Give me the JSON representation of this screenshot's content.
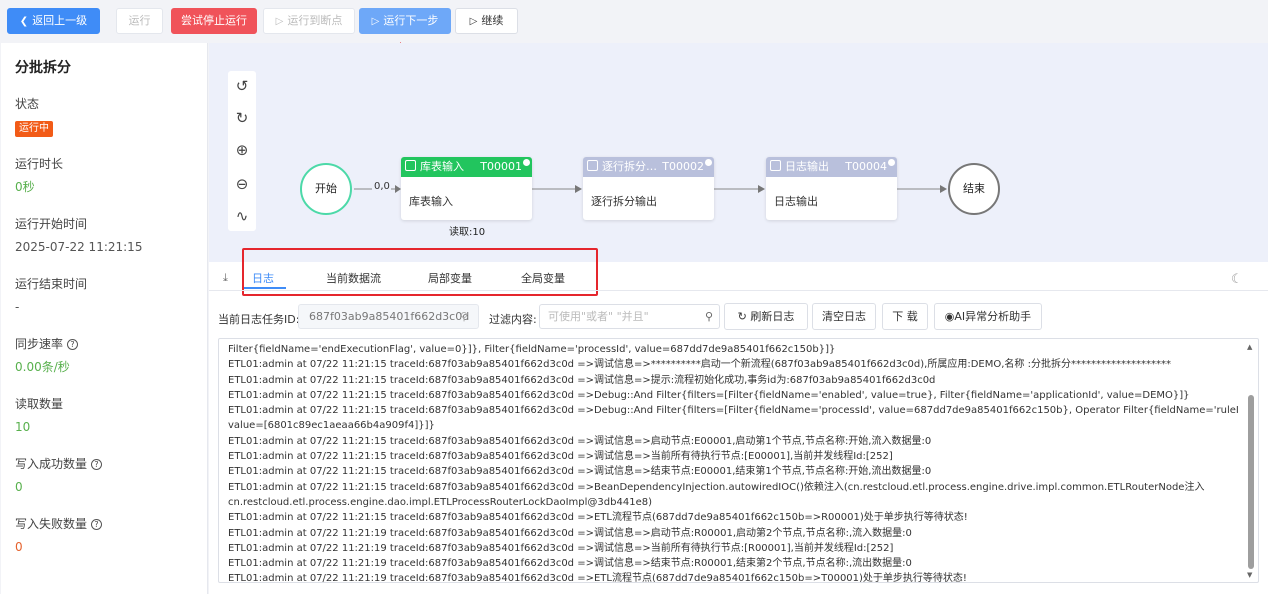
{
  "toolbar": {
    "back": "返回上一级",
    "run": "运行",
    "stop": "尝试停止运行",
    "run_to_breakpoint": "运行到断点",
    "run_next": "运行下一步",
    "continue": "继续"
  },
  "sidebar": {
    "title": "分批拆分",
    "stats": [
      {
        "label": "状态",
        "value": "运行中"
      },
      {
        "label": "运行时长",
        "value": "0秒"
      },
      {
        "label": "运行开始时间",
        "value": "2025-07-22 11:21:15"
      },
      {
        "label": "运行结束时间",
        "value": "-"
      },
      {
        "label": "同步速率",
        "value": "0.00条/秒"
      },
      {
        "label": "读取数量",
        "value": "10"
      },
      {
        "label": "写入成功数量",
        "value": "0"
      },
      {
        "label": "写入失败数量",
        "value": "0"
      }
    ]
  },
  "flow": {
    "start": "开始",
    "end": "结束",
    "edge_label": "0,0",
    "read_label": "读取:10",
    "nodes": [
      {
        "name": "库表输入",
        "code": "T00001",
        "body": "库表输入"
      },
      {
        "name": "逐行拆分…",
        "code": "T00002",
        "body": "逐行拆分输出"
      },
      {
        "name": "日志输出",
        "code": "T00004",
        "body": "日志输出"
      }
    ]
  },
  "tabs": [
    "日志",
    "当前数据流",
    "局部变量",
    "全局变量"
  ],
  "filter": {
    "task_label": "当前日志任务ID:",
    "task_value": "687f03ab9a85401f662d3c0d",
    "filter_label": "过滤内容:",
    "filter_placeholder": "可使用\"或者\" \"并且\"",
    "refresh": "刷新日志",
    "clear": "清空日志",
    "download": "下 载",
    "ai": "AI异常分析助手"
  },
  "log_lines": [
    "Filter{fieldName='endExecutionFlag', value=0}]}, Filter{fieldName='processId', value=687dd7de9a85401f662c150b}]}",
    "ETL01:admin at 07/22 11:21:15 traceId:687f03ab9a85401f662d3c0d =>调试信息=>**********启动一个新流程(687f03ab9a85401f662d3c0d),所属应用:DEMO,名称 :分批拆分********************",
    "ETL01:admin at 07/22 11:21:15 traceId:687f03ab9a85401f662d3c0d =>调试信息=>提示:流程初始化成功,事务id为:687f03ab9a85401f662d3c0d",
    "ETL01:admin at 07/22 11:21:15 traceId:687f03ab9a85401f662d3c0d =>Debug::And Filter{filters=[Filter{fieldName='enabled', value=true}, Filter{fieldName='applicationId', value=DEMO}]}",
    "ETL01:admin at 07/22 11:21:15 traceId:687f03ab9a85401f662d3c0d =>Debug::And Filter{filters=[Filter{fieldName='processId', value=687dd7de9a85401f662c150b}, Operator Filter{fieldName='ruleId', operator='$in',",
    "value=[6801c89ec1aeaa66b4a909f4]}]}",
    "ETL01:admin at 07/22 11:21:15 traceId:687f03ab9a85401f662d3c0d =>调试信息=>启动节点:E00001,启动第1个节点,节点名称:开始,流入数据量:0",
    "ETL01:admin at 07/22 11:21:15 traceId:687f03ab9a85401f662d3c0d =>调试信息=>当前所有待执行节点:[E00001],当前并发线程Id:[252]",
    "ETL01:admin at 07/22 11:21:15 traceId:687f03ab9a85401f662d3c0d =>调试信息=>结束节点:E00001,结束第1个节点,节点名称:开始,流出数据量:0",
    "ETL01:admin at 07/22 11:21:15 traceId:687f03ab9a85401f662d3c0d =>BeanDependencyInjection.autowiredIOC()依赖注入(cn.restcloud.etl.process.engine.drive.impl.common.ETLRouterNode注入",
    "cn.restcloud.etl.process.engine.dao.impl.ETLProcessRouterLockDaoImpl@3db441e8)",
    "ETL01:admin at 07/22 11:21:15 traceId:687f03ab9a85401f662d3c0d =>ETL流程节点(687dd7de9a85401f662c150b=>R00001)处于单步执行等待状态!",
    "ETL01:admin at 07/22 11:21:19 traceId:687f03ab9a85401f662d3c0d =>调试信息=>启动节点:R00001,启动第2个节点,节点名称:,流入数据量:0",
    "ETL01:admin at 07/22 11:21:19 traceId:687f03ab9a85401f662d3c0d =>调试信息=>当前所有待执行节点:[R00001],当前并发线程Id:[252]",
    "ETL01:admin at 07/22 11:21:19 traceId:687f03ab9a85401f662d3c0d =>调试信息=>结束节点:R00001,结束第2个节点,节点名称:,流出数据量:0",
    "ETL01:admin at 07/22 11:21:19 traceId:687f03ab9a85401f662d3c0d =>ETL流程节点(687dd7de9a85401f662c150b=>T00001)处于单步执行等待状态!"
  ],
  "colors": {
    "primary": "#3f8cf7",
    "danger": "#f0535a",
    "success": "#22c55e",
    "running_badge": "#f25b17",
    "highlight_box": "#e5262d"
  }
}
